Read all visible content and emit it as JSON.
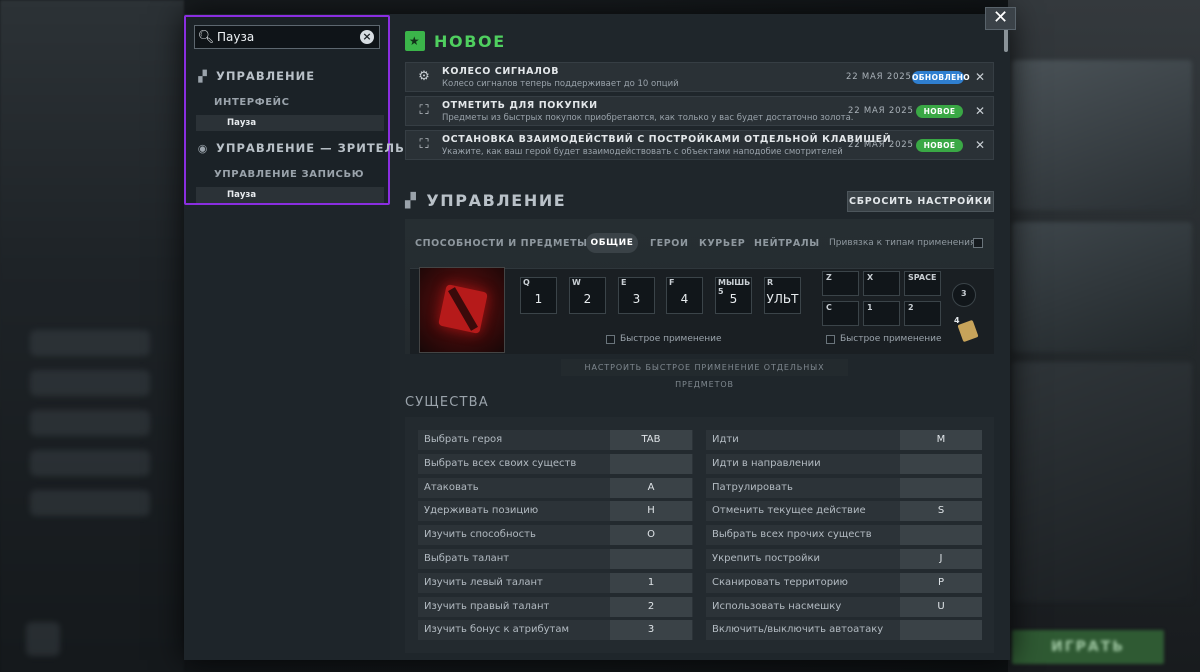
{
  "search": {
    "value": "Пауза",
    "results": [
      {
        "heading": "УПРАВЛЕНИЕ",
        "sub": "ИНТЕРФЕЙС",
        "item": "Пауза"
      },
      {
        "heading": "УПРАВЛЕНИЕ — ЗРИТЕЛЬ",
        "sub": "УПРАВЛЕНИЕ ЗАПИСЬЮ",
        "item": "Пауза"
      }
    ]
  },
  "news": {
    "title": "НОВОЕ",
    "items": [
      {
        "title": "КОЛЕСО СИГНАЛОВ",
        "desc": "Колесо сигналов теперь поддерживает до 10 опций",
        "date": "22 МАЯ 2025",
        "badge": "ОБНОВЛЕНО",
        "badge_color": "#2f7fd0",
        "icon": "gear-icon"
      },
      {
        "title": "ОТМЕТИТЬ ДЛЯ ПОКУПКИ",
        "desc": "Предметы из быстрых покупок приобретаются, как только у вас будет достаточно золота.",
        "date": "22 МАЯ 2025",
        "badge": "НОВОЕ",
        "badge_color": "#3aa845",
        "icon": "shop-icon"
      },
      {
        "title": "ОСТАНОВКА ВЗАИМОДЕЙСТВИЙ С ПОСТРОЙКАМИ ОТДЕЛЬНОЙ КЛАВИШЕЙ",
        "desc": "Укажите, как ваш герой будет взаимодействовать с объектами наподобие смотрителей",
        "date": "22 МАЯ 2025",
        "badge": "НОВОЕ",
        "badge_color": "#3aa845",
        "icon": "building-icon"
      }
    ]
  },
  "controls": {
    "title": "УПРАВЛЕНИЕ",
    "reset_label": "СБРОСИТЬ НАСТРОЙКИ",
    "abilities_label": "СПОСОБНОСТИ И ПРЕДМЕТЫ",
    "tabs": [
      "ОБЩИЕ",
      "ГЕРОИ",
      "КУРЬЕР",
      "НЕЙТРАЛЫ"
    ],
    "active_tab": "ОБЩИЕ",
    "bind_type_label": "Привязка к типам применения",
    "ability_slots": [
      {
        "key": "Q",
        "value": "1"
      },
      {
        "key": "W",
        "value": "2"
      },
      {
        "key": "E",
        "value": "3"
      },
      {
        "key": "F",
        "value": "4"
      },
      {
        "key": "МЫШЬ 5",
        "value": "5"
      },
      {
        "key": "R",
        "value": "УЛЬТ"
      }
    ],
    "item_slots": [
      {
        "key": "Z"
      },
      {
        "key": "X"
      },
      {
        "key": "SPACE"
      },
      {
        "key": "C"
      },
      {
        "key": "1"
      },
      {
        "key": "2"
      }
    ],
    "tp_key": "3",
    "neutral_key": "4",
    "quick_cast_label": "Быстрое применение",
    "item_quick_cast_label": "Быстрое применение",
    "config_link": "НАСТРОИТЬ БЫСТРОЕ ПРИМЕНЕНИЕ ОТДЕЛЬНЫХ ПРЕДМЕТОВ"
  },
  "units": {
    "title": "СУЩЕСТВА",
    "left": [
      {
        "label": "Выбрать героя",
        "key": "TAB"
      },
      {
        "label": "Выбрать всех своих существ",
        "key": ""
      },
      {
        "label": "Атаковать",
        "key": "A"
      },
      {
        "label": "Удерживать позицию",
        "key": "H"
      },
      {
        "label": "Изучить способность",
        "key": "O"
      },
      {
        "label": "Выбрать талант",
        "key": ""
      },
      {
        "label": "Изучить левый талант",
        "key": "1"
      },
      {
        "label": "Изучить правый талант",
        "key": "2"
      },
      {
        "label": "Изучить бонус к атрибутам",
        "key": "3"
      }
    ],
    "right": [
      {
        "label": "Идти",
        "key": "M"
      },
      {
        "label": "Идти в направлении",
        "key": ""
      },
      {
        "label": "Патрулировать",
        "key": ""
      },
      {
        "label": "Отменить текущее действие",
        "key": "S"
      },
      {
        "label": "Выбрать всех прочих существ",
        "key": ""
      },
      {
        "label": "Укрепить постройки",
        "key": "J"
      },
      {
        "label": "Сканировать территорию",
        "key": "P"
      },
      {
        "label": "Использовать насмешку",
        "key": "U"
      },
      {
        "label": "Включить/выключить автоатаку",
        "key": ""
      }
    ]
  },
  "play_label": "ИГРАТЬ",
  "close_label": "✕"
}
